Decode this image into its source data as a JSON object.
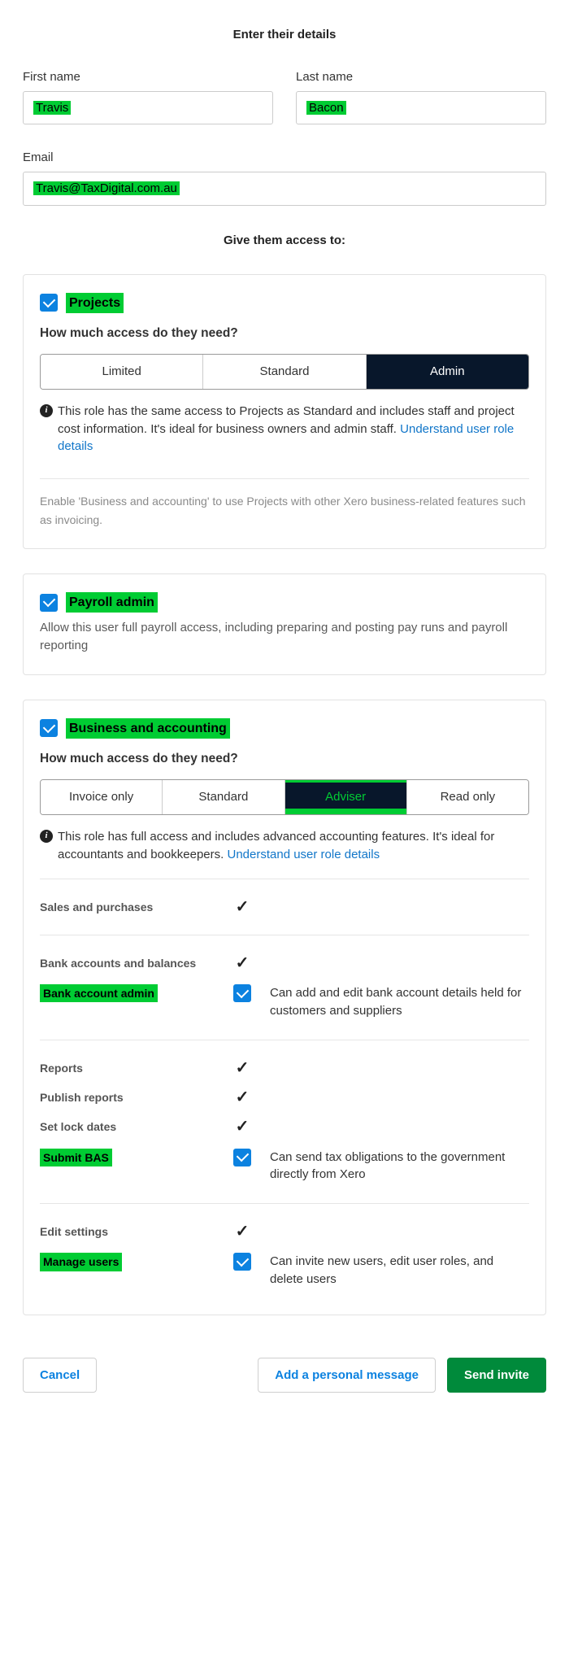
{
  "headings": {
    "enter_details": "Enter their details",
    "give_access": "Give them access to:"
  },
  "fields": {
    "first_name_label": "First name",
    "first_name_value": "Travis",
    "last_name_label": "Last name",
    "last_name_value": "Bacon",
    "email_label": "Email",
    "email_value": "Travis@TaxDigital.com.au"
  },
  "projects": {
    "title": "Projects",
    "question": "How much access do they need?",
    "options": {
      "limited": "Limited",
      "standard": "Standard",
      "admin": "Admin"
    },
    "desc_pre": "This role has the same access to Projects as Standard and includes staff and project cost information. It's ideal for business owners and admin staff. ",
    "desc_link": "Understand user role details",
    "note": "Enable 'Business and accounting' to use Projects with other Xero business-related features such as invoicing."
  },
  "payroll": {
    "title": "Payroll admin",
    "desc": "Allow this user full payroll access, including preparing and posting pay runs and payroll reporting"
  },
  "business": {
    "title": "Business and accounting",
    "question": "How much access do they need?",
    "options": {
      "invoice_only": "Invoice only",
      "standard": "Standard",
      "adviser": "Adviser",
      "read_only": "Read only"
    },
    "desc_pre": "This role has full access and includes advanced accounting features. It's ideal for accountants and bookkeepers. ",
    "desc_link": "Understand user role details",
    "perms": {
      "sales": "Sales and purchases",
      "bank_acc": "Bank accounts and balances",
      "bank_admin": "Bank account admin",
      "bank_admin_desc": "Can add and edit bank account details held for customers and suppliers",
      "reports": "Reports",
      "publish_reports": "Publish reports",
      "set_lock": "Set lock dates",
      "submit_bas": "Submit BAS",
      "submit_bas_desc": "Can send tax obligations to the government directly from Xero",
      "edit_settings": "Edit settings",
      "manage_users": "Manage users",
      "manage_users_desc": "Can invite new users, edit user roles, and delete users"
    }
  },
  "footer": {
    "cancel": "Cancel",
    "add_msg": "Add a personal message",
    "send": "Send invite"
  }
}
